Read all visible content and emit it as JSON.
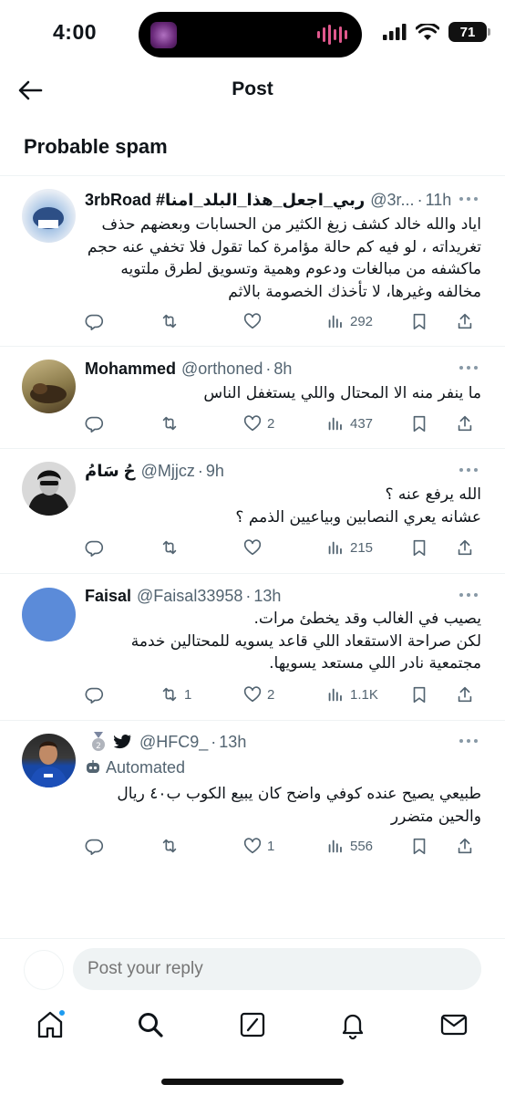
{
  "status_bar": {
    "time": "4:00",
    "battery": "71"
  },
  "header": {
    "title": "Post"
  },
  "section": {
    "title": "Probable spam"
  },
  "tweets": [
    {
      "name": "3rbRoad #ربي_اجعل_هذا_البلد_امنا",
      "handle": "@3r...",
      "time": "11h",
      "text": "اياد والله خالد كشف زيغ الكثير من الحسابات وبعضهم حذف تغريداته ، لو فيه كم حالة مؤامرة كما تقول فلا تخفي عنه حجم ماكشفه من مبالغات ودعوم وهمية وتسويق لطرق ملتويه مخالفه وغيرها، لا تأخذك الخصومة بالاثم",
      "replies": "",
      "retweets": "",
      "likes": "",
      "views": "292"
    },
    {
      "name": "Mohammed",
      "handle": "@orthoned",
      "time": "8h",
      "text": "ما ينفر منه الا المحتال واللي يستغفل الناس",
      "replies": "",
      "retweets": "",
      "likes": "2",
      "views": "437"
    },
    {
      "name": "حُ سَامُ",
      "handle": "@Mjjcz",
      "time": "9h",
      "text_lines": [
        "الله يرفع عنه ؟",
        "عشانه يعري النصابين وبياعيين الذمم ؟"
      ],
      "replies": "",
      "retweets": "",
      "likes": "",
      "views": "215"
    },
    {
      "name": "Faisal",
      "handle": "@Faisal33958",
      "time": "13h",
      "text_lines": [
        "يصيب في الغالب وقد يخطئ مرات.",
        "لكن صراحة الاستقعاد اللي قاعد يسويه للمحتالين خدمة مجتمعية نادر اللي مستعد يسويها."
      ],
      "replies": "",
      "retweets": "1",
      "likes": "2",
      "views": "1.1K"
    },
    {
      "name": "",
      "handle": "@HFC9_",
      "time": "13h",
      "badge": "Automated",
      "text": "طبيعي يصيح عنده كوفي واضح كان يبيع الكوب ب٤٠ ريال والحين متضرر",
      "replies": "",
      "retweets": "",
      "likes": "1",
      "views": "556"
    }
  ],
  "reply": {
    "placeholder": "Post your reply"
  },
  "icons": {
    "reply": "reply-icon",
    "retweet": "retweet-icon",
    "like": "heart-icon",
    "views": "views-icon",
    "bookmark": "bookmark-icon",
    "share": "share-icon"
  },
  "colors": {
    "muted": "#536471",
    "accent": "#1d9bf0",
    "divider": "#eff3f4"
  }
}
